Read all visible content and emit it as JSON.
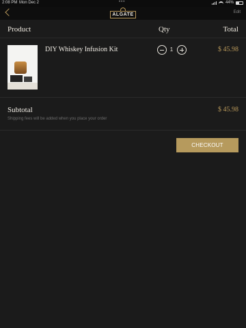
{
  "status_bar": {
    "time": "2:08 PM",
    "date": "Mon Dec 2",
    "top_dots": "•••",
    "battery": "44%",
    "battery_fraction": 0.44
  },
  "nav": {
    "back_icon": "chevron-left-icon",
    "logo_text": "ALGATE",
    "edit_label": "Edit"
  },
  "table_header": {
    "product": "Product",
    "qty": "Qty",
    "total": "Total"
  },
  "items": [
    {
      "name": "DIY Whiskey Infusion Kit",
      "quantity": "1",
      "total": "$ 45.98"
    }
  ],
  "summary": {
    "subtotal_label": "Subtotal",
    "subtotal_value": "$ 45.98",
    "shipping_note": "Shipping fees will be added when you place your order"
  },
  "actions": {
    "checkout_label": "CHECKOUT"
  },
  "colors": {
    "background": "#1b1b1b",
    "accent_gold": "#b69a5d",
    "text": "#e8e4dc"
  }
}
